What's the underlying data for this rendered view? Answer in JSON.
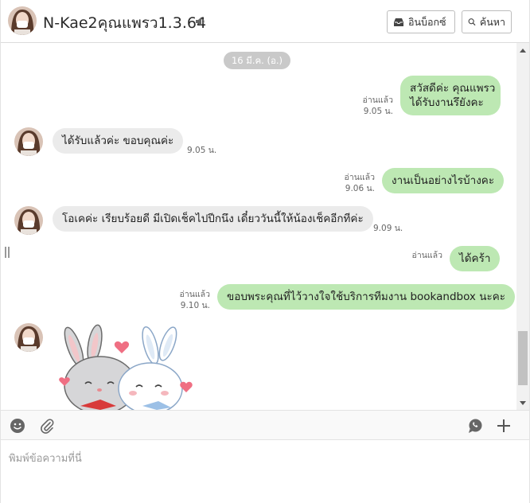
{
  "header": {
    "title": "N-Kae2คุณแพรว1.3.64",
    "inbox_label": "อินบ็อกซ์",
    "search_label": "ค้นหา"
  },
  "chat": {
    "date": "16 มี.ค. (อ.)",
    "messages": [
      {
        "direction": "out",
        "line1": "สวัสดีค่ะ คุณแพรว",
        "line2": "ได้รับงานรึยังคะ",
        "read": "อ่านแล้ว",
        "time": "9.05 น."
      },
      {
        "direction": "in",
        "text": "ได้รับแล้วค่ะ ขอบคุณค่ะ",
        "time": "9.05 น."
      },
      {
        "direction": "out",
        "text": "งานเป็นอย่างไรบ้างคะ",
        "read": "อ่านแล้ว",
        "time": "9.06 น."
      },
      {
        "direction": "in",
        "text": "โอเคค่ะ เรียบร้อยดี มีเปิดเช็คไปปีกนึง เดี๋ยววันนี้ให้น้องเช็คอีกทีค่ะ",
        "time": "9.09 น."
      },
      {
        "direction": "out",
        "text": "ได้คร้า",
        "read": "อ่านแล้ว"
      },
      {
        "direction": "out",
        "text": "ขอบพระคุณที่ไว้วางใจใช้บริการทีมงาน bookandbox นะคะ",
        "read": "อ่านแล้ว",
        "time": "9.10 น."
      },
      {
        "direction": "in",
        "type": "sticker",
        "sticker": "bunny-hug-sticker"
      }
    ]
  },
  "composer": {
    "placeholder": "พิมพ์ข้อความที่นี่"
  },
  "colors": {
    "outgoing_bubble": "#bde8b3",
    "incoming_bubble": "#ebebeb",
    "date_pill": "#c9c9c9"
  }
}
